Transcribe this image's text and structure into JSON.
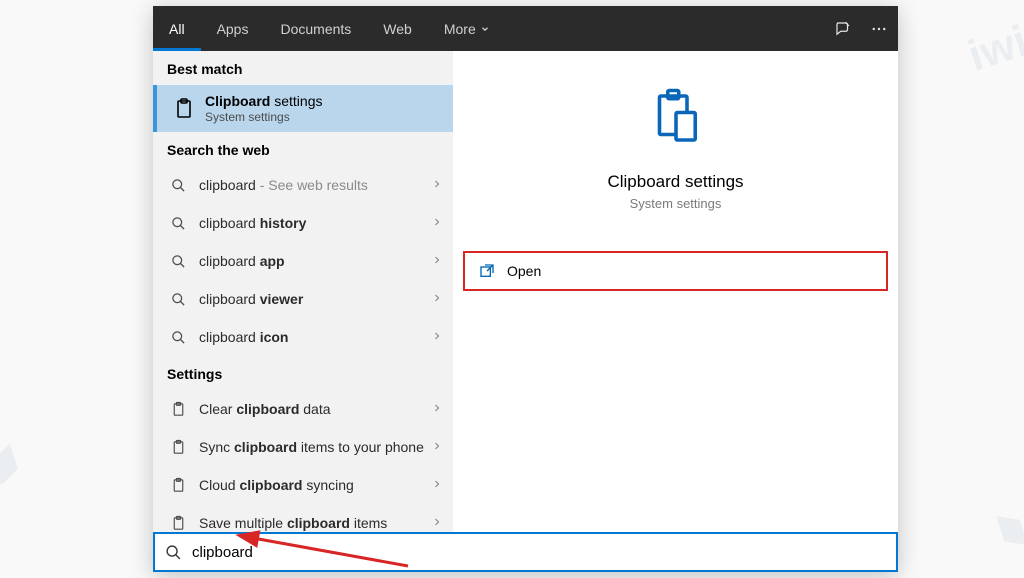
{
  "tabs": {
    "all": "All",
    "apps": "Apps",
    "documents": "Documents",
    "web": "Web",
    "more": "More"
  },
  "sections": {
    "best_match": "Best match",
    "search_web": "Search the web",
    "settings": "Settings"
  },
  "best_match_item": {
    "title_prefix": "Clipboard",
    "title_suffix": " settings",
    "subtitle": "System settings"
  },
  "web_results": [
    {
      "prefix": "clipboard",
      "bold": "",
      "suffix": " - See web results",
      "suffix_muted": true
    },
    {
      "prefix": "clipboard ",
      "bold": "history",
      "suffix": ""
    },
    {
      "prefix": "clipboard ",
      "bold": "app",
      "suffix": ""
    },
    {
      "prefix": "clipboard ",
      "bold": "viewer",
      "suffix": ""
    },
    {
      "prefix": "clipboard ",
      "bold": "icon",
      "suffix": ""
    }
  ],
  "settings_results": [
    {
      "prefix": "Clear ",
      "bold": "clipboard",
      "suffix": " data"
    },
    {
      "prefix": "Sync ",
      "bold": "clipboard",
      "suffix": " items to your phone"
    },
    {
      "prefix": "Cloud ",
      "bold": "clipboard",
      "suffix": " syncing"
    },
    {
      "prefix": "Save multiple ",
      "bold": "clipboard",
      "suffix": " items"
    }
  ],
  "details": {
    "title": "Clipboard settings",
    "subtitle": "System settings",
    "open": "Open"
  },
  "search_query": "clipboard"
}
